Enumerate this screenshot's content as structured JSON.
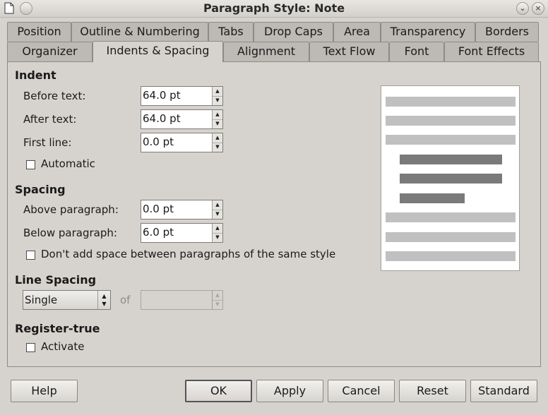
{
  "window": {
    "title": "Paragraph Style: Note"
  },
  "tabs_row1": [
    "Position",
    "Outline & Numbering",
    "Tabs",
    "Drop Caps",
    "Area",
    "Transparency",
    "Borders"
  ],
  "tabs_row2": [
    "Organizer",
    "Indents & Spacing",
    "Alignment",
    "Text Flow",
    "Font",
    "Font Effects"
  ],
  "active_tab": "Indents & Spacing",
  "indent": {
    "title": "Indent",
    "before_text_label": "Before text:",
    "before_text_value": "64.0 pt",
    "after_text_label": "After text:",
    "after_text_value": "64.0 pt",
    "first_line_label": "First line:",
    "first_line_value": "0.0 pt",
    "automatic_label": "Automatic",
    "automatic_checked": false
  },
  "spacing": {
    "title": "Spacing",
    "above_label": "Above paragraph:",
    "above_value": "0.0 pt",
    "below_label": "Below paragraph:",
    "below_value": "6.0 pt",
    "dont_add_label": "Don't add space between paragraphs of the same style",
    "dont_add_checked": false
  },
  "line_spacing": {
    "title": "Line Spacing",
    "selected": "Single",
    "of_label": "of",
    "of_value": ""
  },
  "register_true": {
    "title": "Register-true",
    "activate_label": "Activate",
    "activate_checked": false
  },
  "buttons": {
    "help": "Help",
    "ok": "OK",
    "apply": "Apply",
    "cancel": "Cancel",
    "reset": "Reset",
    "standard": "Standard"
  },
  "icons": {
    "window_icon": "document-icon",
    "minimize": "chevron-down-icon",
    "close": "close-icon"
  },
  "colors": {
    "dialog_bg": "#d6d3ce",
    "preview_light_line": "#c0c0c0",
    "preview_dark_line": "#7a7a7a"
  }
}
